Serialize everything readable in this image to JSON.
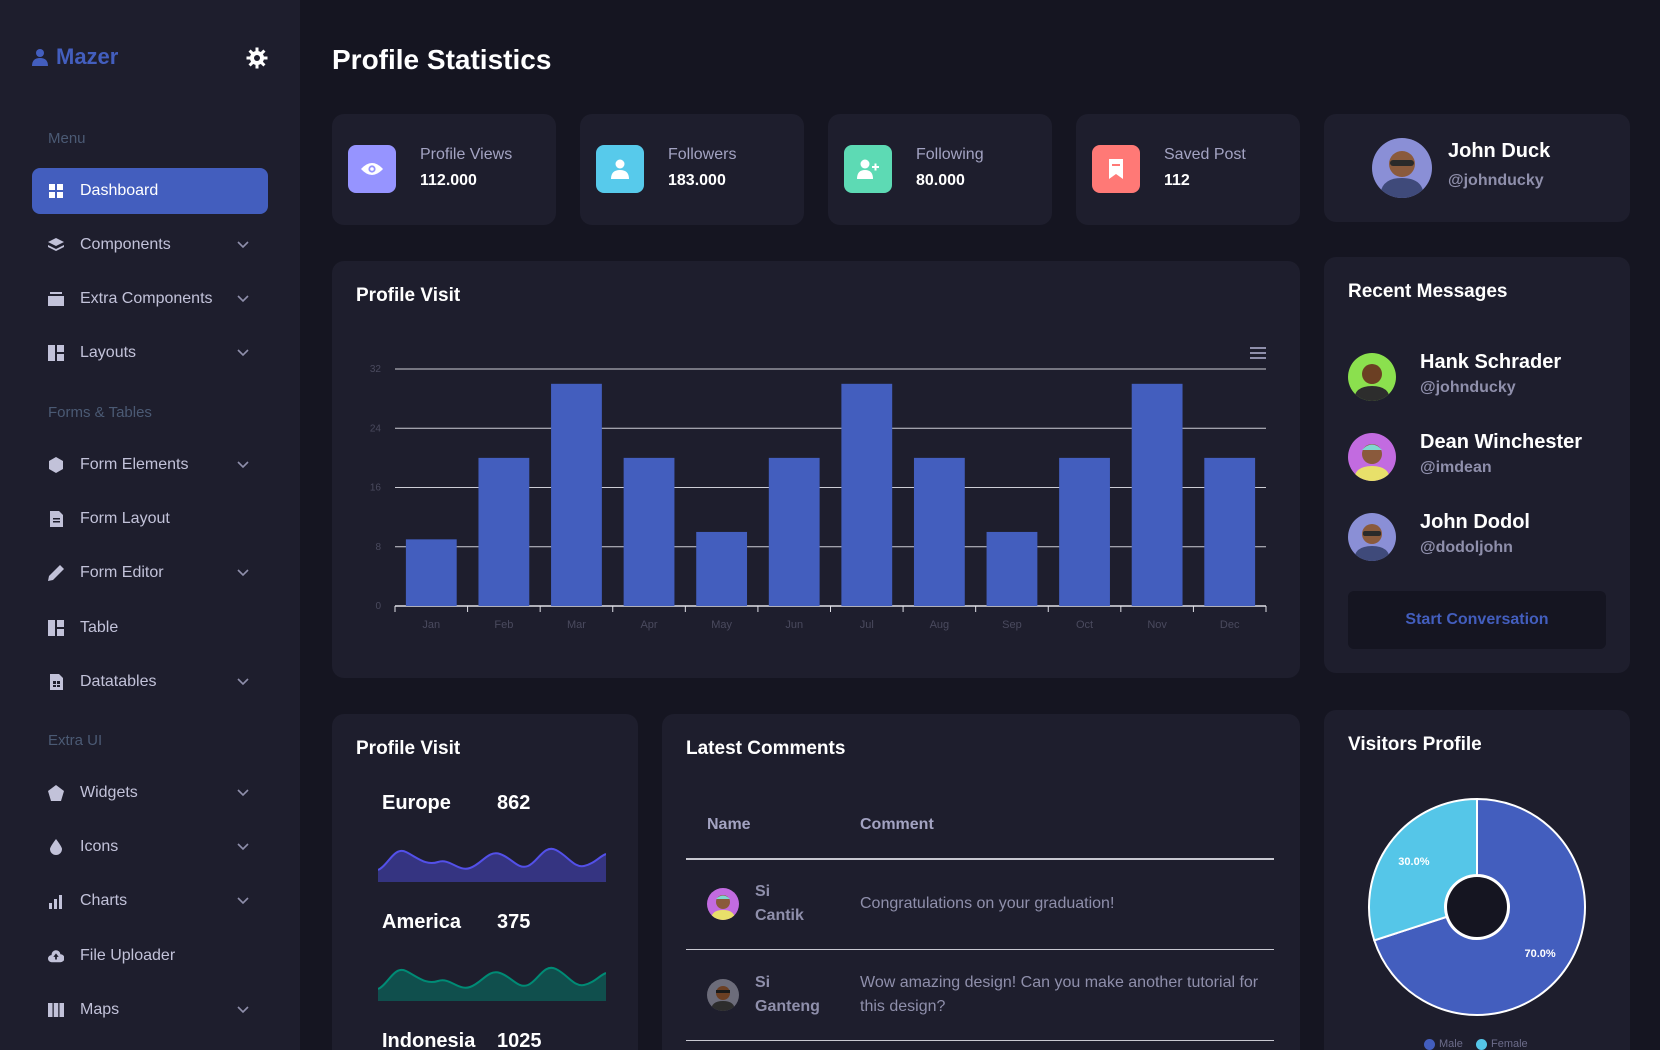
{
  "app": {
    "brand": "Mazer"
  },
  "sidebar": {
    "sections": [
      "Menu",
      "Forms & Tables",
      "Extra UI"
    ],
    "items": [
      {
        "label": "Dashboard",
        "icon": "grid-icon"
      },
      {
        "label": "Components",
        "icon": "stack-icon"
      },
      {
        "label": "Extra Components",
        "icon": "collection-icon"
      },
      {
        "label": "Layouts",
        "icon": "layout-icon"
      },
      {
        "label": "Form Elements",
        "icon": "hexagon-icon"
      },
      {
        "label": "Form Layout",
        "icon": "file-text-icon"
      },
      {
        "label": "Form Editor",
        "icon": "pen-icon"
      },
      {
        "label": "Table",
        "icon": "table-icon"
      },
      {
        "label": "Datatables",
        "icon": "file-spreadsheet-icon"
      },
      {
        "label": "Widgets",
        "icon": "pentagon-icon"
      },
      {
        "label": "Icons",
        "icon": "droplet-icon"
      },
      {
        "label": "Charts",
        "icon": "bar-chart-icon"
      },
      {
        "label": "File Uploader",
        "icon": "cloud-upload-icon"
      },
      {
        "label": "Maps",
        "icon": "map-icon"
      }
    ]
  },
  "page": {
    "title": "Profile Statistics"
  },
  "stats": [
    {
      "label": "Profile Views",
      "value": "112.000",
      "color": "#9694ff",
      "icon": "eye-icon"
    },
    {
      "label": "Followers",
      "value": "183.000",
      "color": "#57caeb",
      "icon": "person-icon"
    },
    {
      "label": "Following",
      "value": "80.000",
      "color": "#5ddab4",
      "icon": "person-add-icon"
    },
    {
      "label": "Saved Post",
      "value": "112",
      "color": "#ff7976",
      "icon": "bookmark-icon"
    }
  ],
  "profile": {
    "name": "John Duck",
    "handle": "@johnducky"
  },
  "profile_visit": {
    "title": "Profile Visit"
  },
  "chart_data": {
    "type": "bar",
    "title": "Profile Visit",
    "categories": [
      "Jan",
      "Feb",
      "Mar",
      "Apr",
      "May",
      "Jun",
      "Jul",
      "Aug",
      "Sep",
      "Oct",
      "Nov",
      "Dec"
    ],
    "values": [
      9,
      20,
      30,
      20,
      10,
      20,
      30,
      20,
      10,
      20,
      30,
      20
    ],
    "ylim": [
      0,
      32
    ],
    "yticks": [
      "0",
      "8",
      "16",
      "24",
      "32"
    ],
    "color": "#435ebe",
    "grid": true
  },
  "recent_messages": {
    "title": "Recent Messages",
    "items": [
      {
        "name": "Hank Schrader",
        "handle": "@johnducky",
        "bg": "#8be04e"
      },
      {
        "name": "Dean Winchester",
        "handle": "@imdean",
        "bg": "#c26be0"
      },
      {
        "name": "John Dodol",
        "handle": "@dodoljohn",
        "bg": "#8a8fd6"
      }
    ],
    "button": "Start Conversation"
  },
  "regions": {
    "title": "Profile Visit",
    "items": [
      {
        "name": "Europe",
        "value": "862",
        "color": "#5350e9"
      },
      {
        "name": "America",
        "value": "375",
        "color": "#008b75"
      },
      {
        "name": "Indonesia",
        "value": "1025",
        "color": "#dc3545"
      }
    ]
  },
  "comments": {
    "title": "Latest Comments",
    "headers": [
      "Name",
      "Comment"
    ],
    "rows": [
      {
        "name": "Si Cantik",
        "comment": "Congratulations on your graduation!"
      },
      {
        "name": "Si Ganteng",
        "comment": "Wow amazing design! Can you make another tutorial for this design?"
      }
    ]
  },
  "visitors": {
    "title": "Visitors Profile",
    "slices": [
      {
        "label": "Male",
        "value": 70.0,
        "text": "70.0%",
        "color": "#435ebe"
      },
      {
        "label": "Female",
        "value": 30.0,
        "text": "30.0%",
        "color": "#55c6e8"
      }
    ]
  }
}
